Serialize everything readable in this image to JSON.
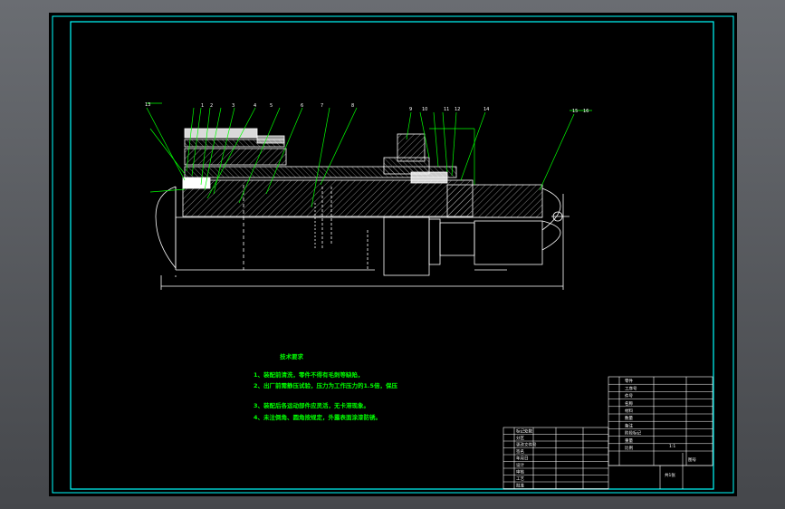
{
  "drawing": {
    "frame_color": "#00ffff",
    "part_color": "#ffffff",
    "leader_color": "#00ff00",
    "hatch_color": "#ffffff",
    "balloons": [
      "13",
      "1",
      "2",
      "3",
      "4",
      "5",
      "6",
      "7",
      "8",
      "9",
      "10",
      "11",
      "12",
      "14",
      "15",
      "16"
    ]
  },
  "notes": {
    "title": "技术要求",
    "items": [
      "1、装配前清洗，零件不得有毛刺等缺陷，",
      "2、出厂前需静压试验，压力为工作压力的1.5倍，保压",
      "3、装配后各运动部件应灵活，无卡滞现象。",
      "4、未注倒角、圆角按规定，外露表面涂漆防锈。"
    ]
  },
  "title_block": {
    "rev_rows": [
      "标记处数",
      "分区",
      "更改文件号",
      "签名",
      "年月日",
      "设计",
      "审核",
      "工艺",
      "批准"
    ],
    "right_rows": [
      "零件",
      "工序号",
      "件号",
      "名称",
      "材料",
      "数量",
      "备注",
      "阶段标记",
      "重量",
      "比例"
    ],
    "scale": "1:1",
    "sheet": "共1张",
    "code": "图号"
  }
}
